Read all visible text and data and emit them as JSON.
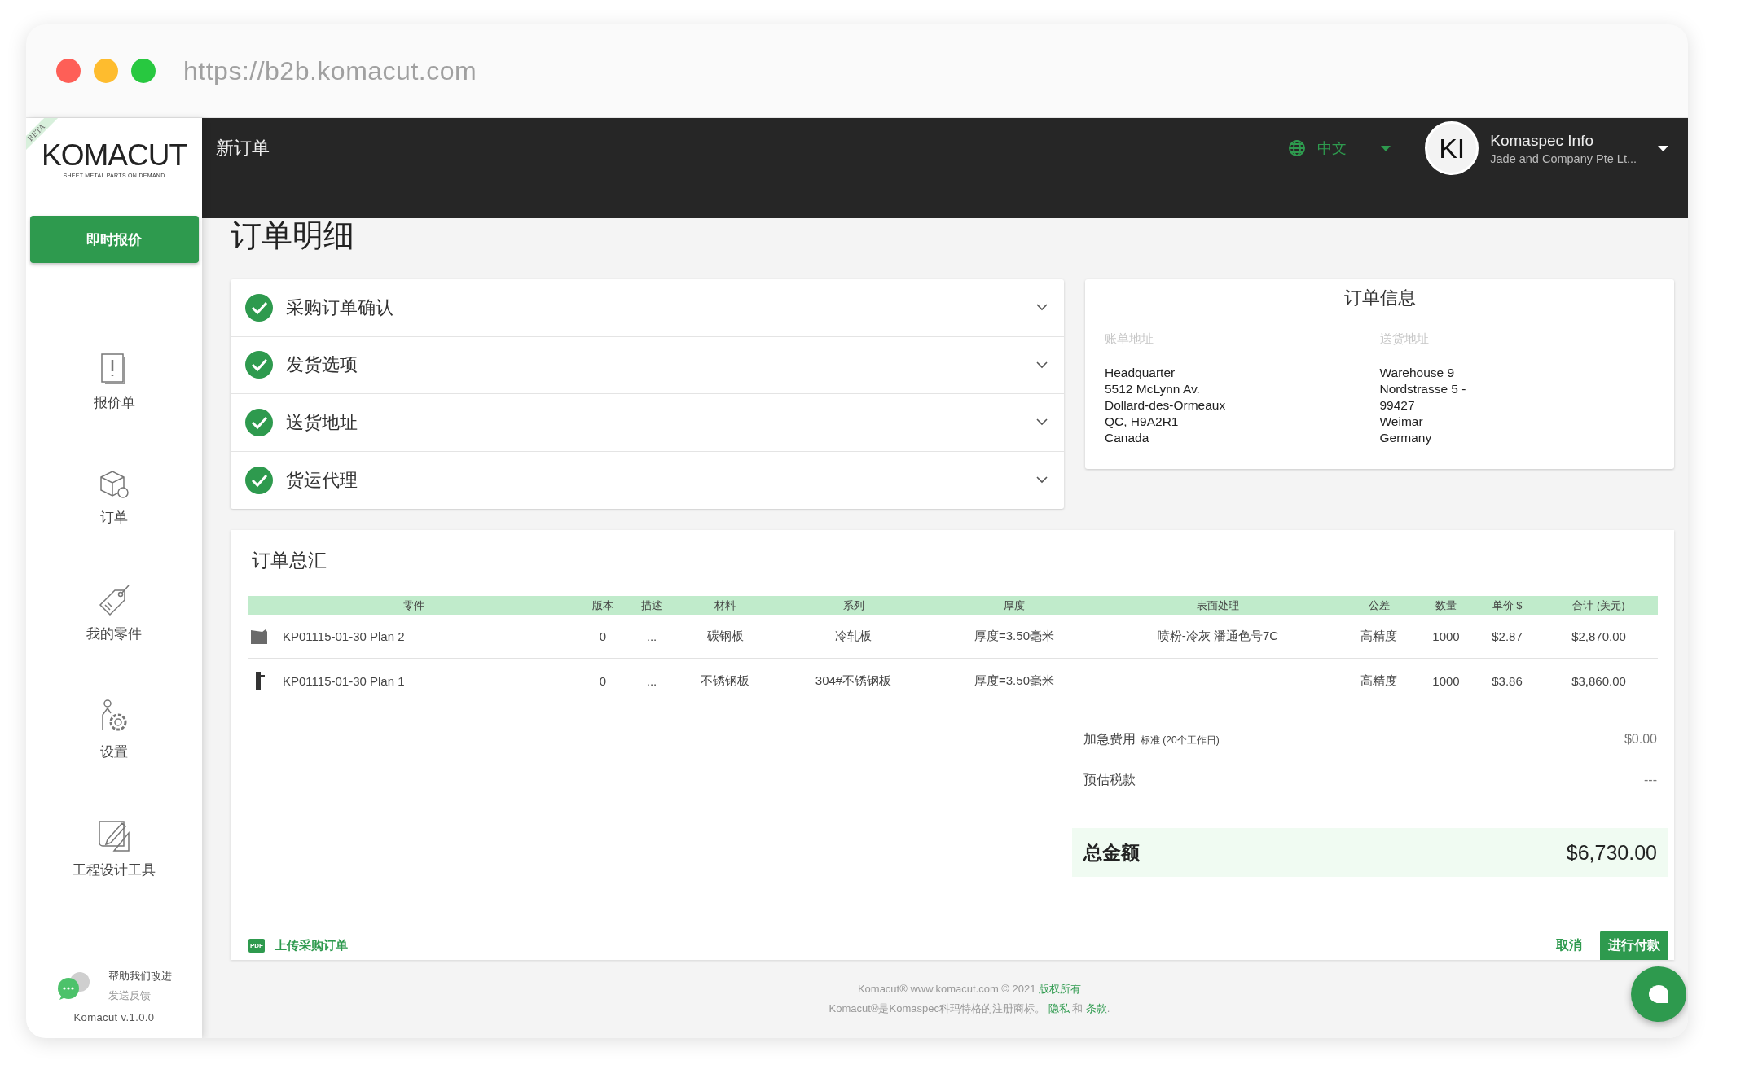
{
  "browser": {
    "url": "https://b2b.komacut.com"
  },
  "sidebar": {
    "logo": {
      "name": "KOMACUT",
      "tagline": "SHEET METAL PARTS ON DEMAND",
      "ribbon": "BETA"
    },
    "quote_button": "即时报价",
    "items": [
      {
        "label": "报价单",
        "kind": "quotes"
      },
      {
        "label": "订单",
        "kind": "orders"
      },
      {
        "label": "我的零件",
        "kind": "parts"
      },
      {
        "label": "设置",
        "kind": "settings"
      },
      {
        "label": "工程设计工具",
        "kind": "tools"
      }
    ],
    "feedback": {
      "title": "帮助我们改进",
      "link": "发送反馈"
    },
    "version": "Komacut v.1.0.0"
  },
  "header": {
    "title": "新订单",
    "language": "中文",
    "user": {
      "initials": "KI",
      "name": "Komaspec Info",
      "company": "Jade and Company Pte Lt..."
    }
  },
  "page_title": "订单明细",
  "steps": [
    {
      "label": "采购订单确认",
      "done": true,
      "expanded": false
    },
    {
      "label": "发货选项",
      "done": true,
      "expanded": false
    },
    {
      "label": "送货地址",
      "done": true,
      "expanded": false
    },
    {
      "label": "货运代理",
      "done": true,
      "expanded": false
    }
  ],
  "order_info": {
    "title": "订单信息",
    "billing": {
      "label": "账单地址",
      "lines": [
        "Headquarter",
        "5512 McLynn Av.",
        "Dollard-des-Ormeaux",
        "QC, H9A2R1",
        "Canada"
      ]
    },
    "shipping": {
      "label": "送货地址",
      "lines": [
        "Warehouse 9",
        "Nordstrasse 5 -",
        "99427",
        "Weimar",
        "Germany"
      ]
    }
  },
  "summary": {
    "title": "订单总汇",
    "table": {
      "columns": [
        "零件",
        "版本",
        "描述",
        "材料",
        "系列",
        "厚度",
        "表面处理",
        "公差",
        "数量",
        "单价 $",
        "合计 (美元)"
      ],
      "rows": [
        {
          "part": "KP01115-01-30 Plan 2",
          "revision": "0",
          "description": "...",
          "material": "碳钢板",
          "series": "冷轧板",
          "thickness": "厚度=3.50毫米",
          "finish": "喷粉-冷灰 潘通色号7C",
          "tolerance": "高精度",
          "quantity": "1000",
          "unit_price": "$2.87",
          "total": "$2,870.00",
          "kind": "bent"
        },
        {
          "part": "KP01115-01-30 Plan 1",
          "revision": "0",
          "description": "...",
          "material": "不锈钢板",
          "series": "304#不锈钢板",
          "thickness": "厚度=3.50毫米",
          "tolerance": "高精度",
          "quantity": "1000",
          "unit_price": "$3.86",
          "total": "$3,860.00",
          "kind": "bracket"
        }
      ]
    },
    "fees": [
      {
        "label": "加急费用",
        "note": "标准 (20个工作日)",
        "value": "$0.00"
      },
      {
        "label": "预估税款",
        "value": "---"
      }
    ],
    "total": {
      "label": "总金额",
      "value": "$6,730.00"
    },
    "upload": "上传采购订单",
    "upload_badge": "PDF",
    "cancel": "取消",
    "pay": "进行付款"
  },
  "footer": {
    "lines": [
      [
        {
          "kind": "text",
          "text": "Komacut® www.komacut.com © 2021 "
        },
        {
          "kind": "link",
          "text": "版权所有"
        }
      ],
      [
        {
          "kind": "text",
          "text": "Komacut®是Komaspec科玛特格的注册商标。 "
        },
        {
          "kind": "link",
          "text": "隐私"
        },
        {
          "kind": "text",
          "text": " 和 "
        },
        {
          "kind": "link",
          "text": "条款"
        },
        {
          "kind": "text",
          "text": "."
        }
      ]
    ]
  }
}
